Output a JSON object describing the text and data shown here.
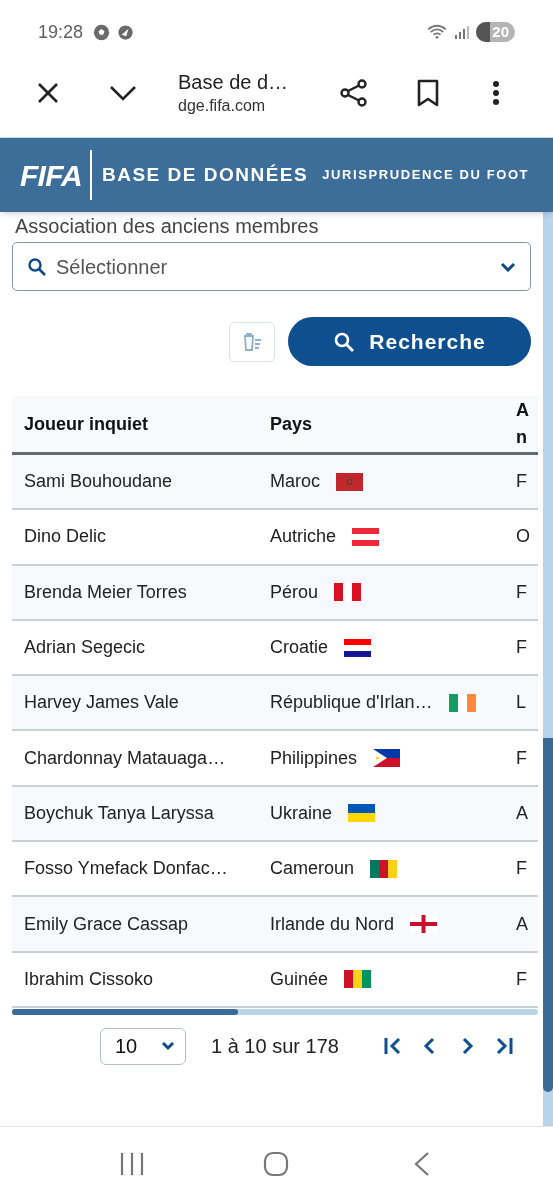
{
  "status_bar": {
    "time": "19:28",
    "battery": "20"
  },
  "browser": {
    "title": "Base de d…",
    "url": "dge.fifa.com"
  },
  "site_header": {
    "logo": "FIFA",
    "title": "BASE DE DONNÉES",
    "subtitle": "JURISPRUDENCE DU FOOT"
  },
  "filter": {
    "label": "Association des anciens membres",
    "placeholder": "Sélectionner"
  },
  "search_button": {
    "label": "Recherche"
  },
  "table": {
    "columns": [
      "Joueur inquiet",
      "Pays",
      "A\nn"
    ],
    "rows": [
      {
        "player": "Sami Bouhoudane",
        "country": "Maroc",
        "kind": "morocco",
        "column_3": "F"
      },
      {
        "player": "Dino Delic",
        "country": "Autriche",
        "kind": "austria",
        "column_3": "O"
      },
      {
        "player": "Brenda Meier Torres",
        "country": "Pérou",
        "kind": "peru",
        "column_3": "F"
      },
      {
        "player": "Adrian Segecic",
        "country": "Croatie",
        "kind": "croatia",
        "column_3": "F"
      },
      {
        "player": "Harvey James Vale",
        "country": "République d'Irlan…",
        "kind": "ireland",
        "column_3": "L"
      },
      {
        "player": "Chardonnay Matauaga…",
        "country": "Philippines",
        "kind": "philippines",
        "column_3": "F"
      },
      {
        "player": "Boychuk Tanya Laryssa",
        "country": "Ukraine",
        "kind": "ukraine",
        "column_3": "A"
      },
      {
        "player": "Fosso Ymefack Donfac…",
        "country": "Cameroun",
        "kind": "cameroon",
        "column_3": "F"
      },
      {
        "player": "Emily Grace Cassap",
        "country": "Irlande du Nord",
        "kind": "northern-ireland",
        "column_3": "A"
      },
      {
        "player": "Ibrahim Cissoko",
        "country": "Guinée",
        "kind": "guinea",
        "column_3": "F"
      }
    ]
  },
  "pagination": {
    "page_size": "10",
    "range": "1 à 10 sur 178"
  }
}
